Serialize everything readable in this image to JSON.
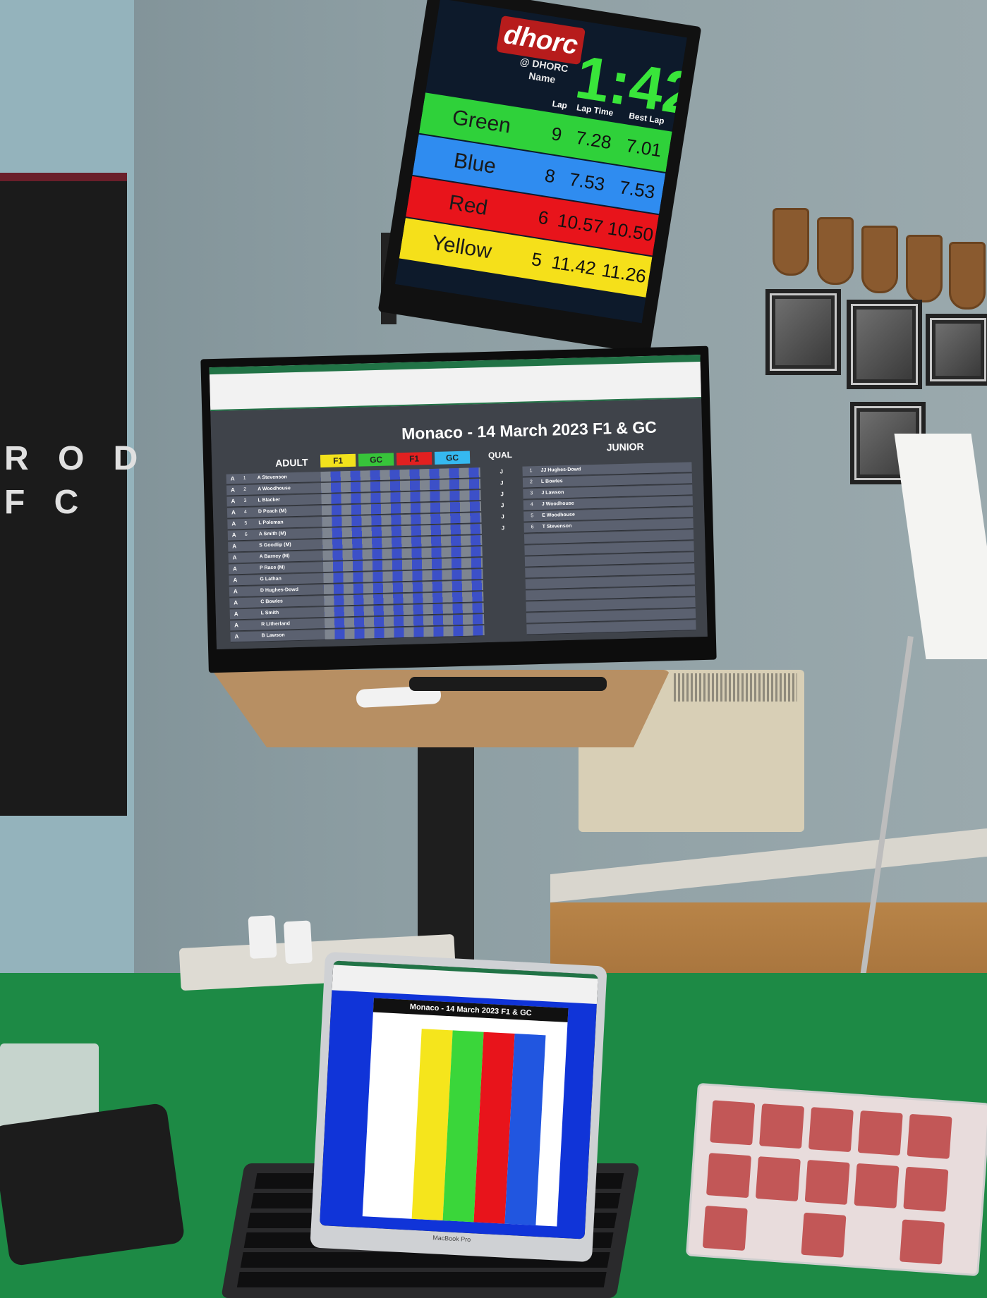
{
  "banner": {
    "letters": "R O D\nF C"
  },
  "top_monitor": {
    "logo": "dhorc",
    "handle": "@ DHORC",
    "name_header": "Name",
    "timer": "1:42",
    "columns": {
      "lap": "Lap",
      "lap_time": "Lap Time",
      "best_lap": "Best Lap"
    },
    "rows": [
      {
        "name": "Green",
        "lap": "9",
        "lap_time": "7.28",
        "best_lap": "7.01",
        "color": "#2fd13a"
      },
      {
        "name": "Blue",
        "lap": "8",
        "lap_time": "7.53",
        "best_lap": "7.53",
        "color": "#2f8cf0"
      },
      {
        "name": "Red",
        "lap": "6",
        "lap_time": "10.57",
        "best_lap": "10.50",
        "color": "#e8141b"
      },
      {
        "name": "Yellow",
        "lap": "5",
        "lap_time": "11.42",
        "best_lap": "11.26",
        "color": "#f5e01a"
      }
    ]
  },
  "big_monitor": {
    "title": "Monaco - 14 March 2023 F1 & GC",
    "adult_label": "ADULT",
    "junior_label": "JUNIOR",
    "qual_label": "QUAL",
    "headers": [
      {
        "label": "F1",
        "color": "#f2e21c"
      },
      {
        "label": "GC",
        "color": "#37c43a"
      },
      {
        "label": "F1",
        "color": "#e22020"
      },
      {
        "label": "GC",
        "color": "#35b9f0"
      }
    ],
    "adult_rows": [
      {
        "pos": "1",
        "cls": "A",
        "name": "A Stevenson"
      },
      {
        "pos": "2",
        "cls": "A",
        "name": "A Woodhouse"
      },
      {
        "pos": "3",
        "cls": "A",
        "name": "L Blacker"
      },
      {
        "pos": "4",
        "cls": "A",
        "name": "D Peach (M)"
      },
      {
        "pos": "5",
        "cls": "A",
        "name": "L Poleman"
      },
      {
        "pos": "6",
        "cls": "A",
        "name": "A Smith (M)"
      },
      {
        "pos": "",
        "cls": "A",
        "name": "S Goodlip (M)"
      },
      {
        "pos": "",
        "cls": "A",
        "name": "A Barney (M)"
      },
      {
        "pos": "",
        "cls": "A",
        "name": "P Race (M)"
      },
      {
        "pos": "",
        "cls": "A",
        "name": "G Lathan"
      },
      {
        "pos": "",
        "cls": "A",
        "name": "D Hughes-Dowd"
      },
      {
        "pos": "",
        "cls": "A",
        "name": "C Bowles"
      },
      {
        "pos": "",
        "cls": "A",
        "name": "L Smith"
      },
      {
        "pos": "",
        "cls": "A",
        "name": "R Litherland"
      },
      {
        "pos": "",
        "cls": "A",
        "name": "B Lawson"
      }
    ],
    "junior_rows": [
      {
        "pos": "1",
        "cls": "J",
        "name": "JJ Hughes-Dowd"
      },
      {
        "pos": "2",
        "cls": "J",
        "name": "L Bowles"
      },
      {
        "pos": "3",
        "cls": "J",
        "name": "J Lawson"
      },
      {
        "pos": "4",
        "cls": "J",
        "name": "J Woodhouse"
      },
      {
        "pos": "5",
        "cls": "J",
        "name": "E Woodhouse"
      },
      {
        "pos": "6",
        "cls": "J",
        "name": "T Stevenson"
      }
    ]
  },
  "laptop": {
    "title": "Monaco - 14 March 2023 F1 & GC",
    "brand": "MacBook Pro",
    "column_colors": [
      "#f5e51c",
      "#3ad63a",
      "#e8141b",
      "#2156e0"
    ]
  }
}
